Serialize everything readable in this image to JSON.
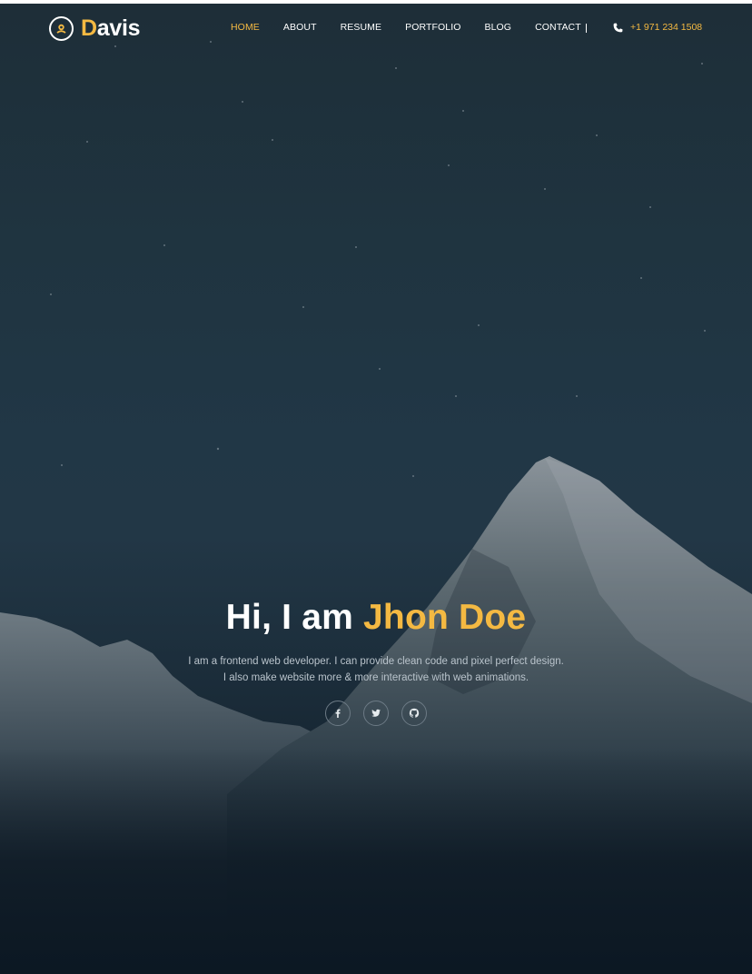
{
  "header": {
    "logo": {
      "initial": "D",
      "rest": "avis"
    },
    "nav": [
      {
        "label": "HOME",
        "active": true
      },
      {
        "label": "ABOUT",
        "active": false
      },
      {
        "label": "RESUME",
        "active": false
      },
      {
        "label": "PORTFOLIO",
        "active": false
      },
      {
        "label": "BLOG",
        "active": false
      },
      {
        "label": "CONTACT",
        "active": false
      }
    ],
    "phone": "+1 971 234 1508"
  },
  "hero": {
    "greeting": "Hi, I am",
    "name": "Jhon Doe",
    "description_line1": "I am a frontend web developer. I can provide clean code and pixel perfect design.",
    "description_line2": "I also make website more & more interactive with web animations.",
    "socials": [
      "facebook-icon",
      "twitter-icon",
      "github-icon"
    ]
  },
  "colors": {
    "accent": "#f4b942",
    "text": "#ffffff",
    "muted_text": "#b9c3cb",
    "background": "#1f3440"
  }
}
